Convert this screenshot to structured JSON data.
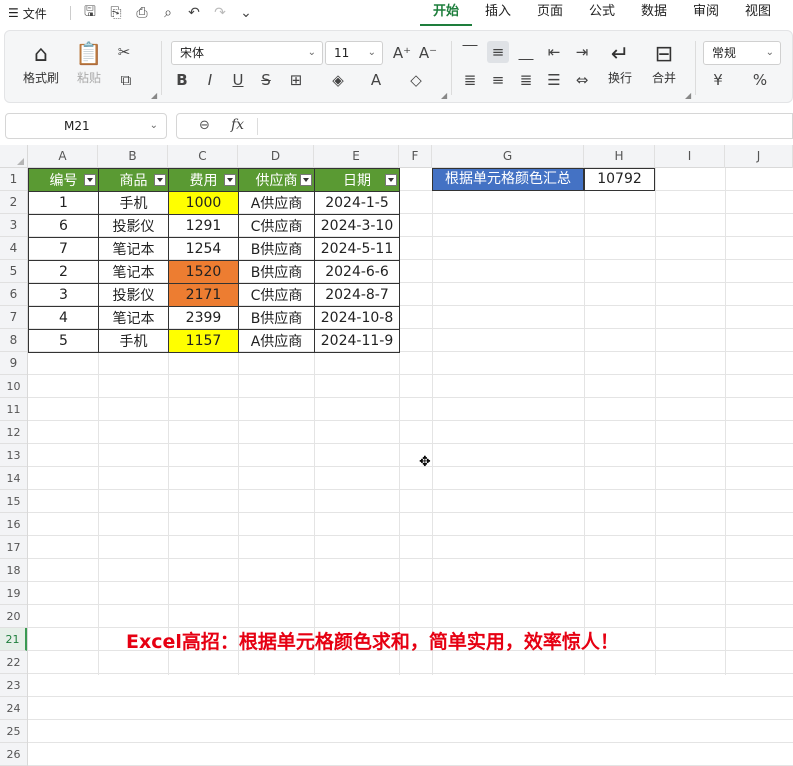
{
  "menubar": {
    "file_label": "文件",
    "tabs": [
      "开始",
      "插入",
      "页面",
      "公式",
      "数据",
      "审阅",
      "视图"
    ],
    "active_tab": "开始"
  },
  "ribbon": {
    "format_painter": "格式刷",
    "paste": "粘贴",
    "font_name": "宋体",
    "font_size": "11",
    "wrap": "换行",
    "merge": "合并",
    "number_format": "常规",
    "currency_symbol": "¥",
    "percent_symbol": "%"
  },
  "formula_bar": {
    "name_box": "M21",
    "fx_label": "fx",
    "formula": ""
  },
  "columns": [
    "A",
    "B",
    "C",
    "D",
    "E",
    "F",
    "G",
    "H",
    "I",
    "J"
  ],
  "rows": [
    "1",
    "2",
    "3",
    "4",
    "5",
    "6",
    "7",
    "8",
    "9",
    "10",
    "11",
    "12",
    "13",
    "14",
    "15",
    "16",
    "17",
    "18",
    "19",
    "20",
    "21",
    "22",
    "23",
    "24",
    "25",
    "26"
  ],
  "active_row": "21",
  "table": {
    "headers": [
      "编号",
      "商品",
      "费用",
      "供应商",
      "日期"
    ],
    "rows": [
      {
        "id": "1",
        "product": "手机",
        "cost": "1000",
        "supplier": "A供应商",
        "date": "2024-1-5",
        "fill": "yellow"
      },
      {
        "id": "6",
        "product": "投影仪",
        "cost": "1291",
        "supplier": "C供应商",
        "date": "2024-3-10",
        "fill": ""
      },
      {
        "id": "7",
        "product": "笔记本",
        "cost": "1254",
        "supplier": "B供应商",
        "date": "2024-5-11",
        "fill": ""
      },
      {
        "id": "2",
        "product": "笔记本",
        "cost": "1520",
        "supplier": "B供应商",
        "date": "2024-6-6",
        "fill": "orange"
      },
      {
        "id": "3",
        "product": "投影仪",
        "cost": "2171",
        "supplier": "C供应商",
        "date": "2024-8-7",
        "fill": "orange"
      },
      {
        "id": "4",
        "product": "笔记本",
        "cost": "2399",
        "supplier": "B供应商",
        "date": "2024-10-8",
        "fill": ""
      },
      {
        "id": "5",
        "product": "手机",
        "cost": "1157",
        "supplier": "A供应商",
        "date": "2024-11-9",
        "fill": "yellow"
      }
    ],
    "fill_colors": {
      "yellow": "#ffff00",
      "orange": "#ed7d31"
    },
    "header_color": "#5a9a33"
  },
  "summary": {
    "label": "根据单元格颜色汇总",
    "value": "10792",
    "label_color": "#4472c4"
  },
  "caption": "Excel高招：根据单元格颜色求和，简单实用，效率惊人！"
}
